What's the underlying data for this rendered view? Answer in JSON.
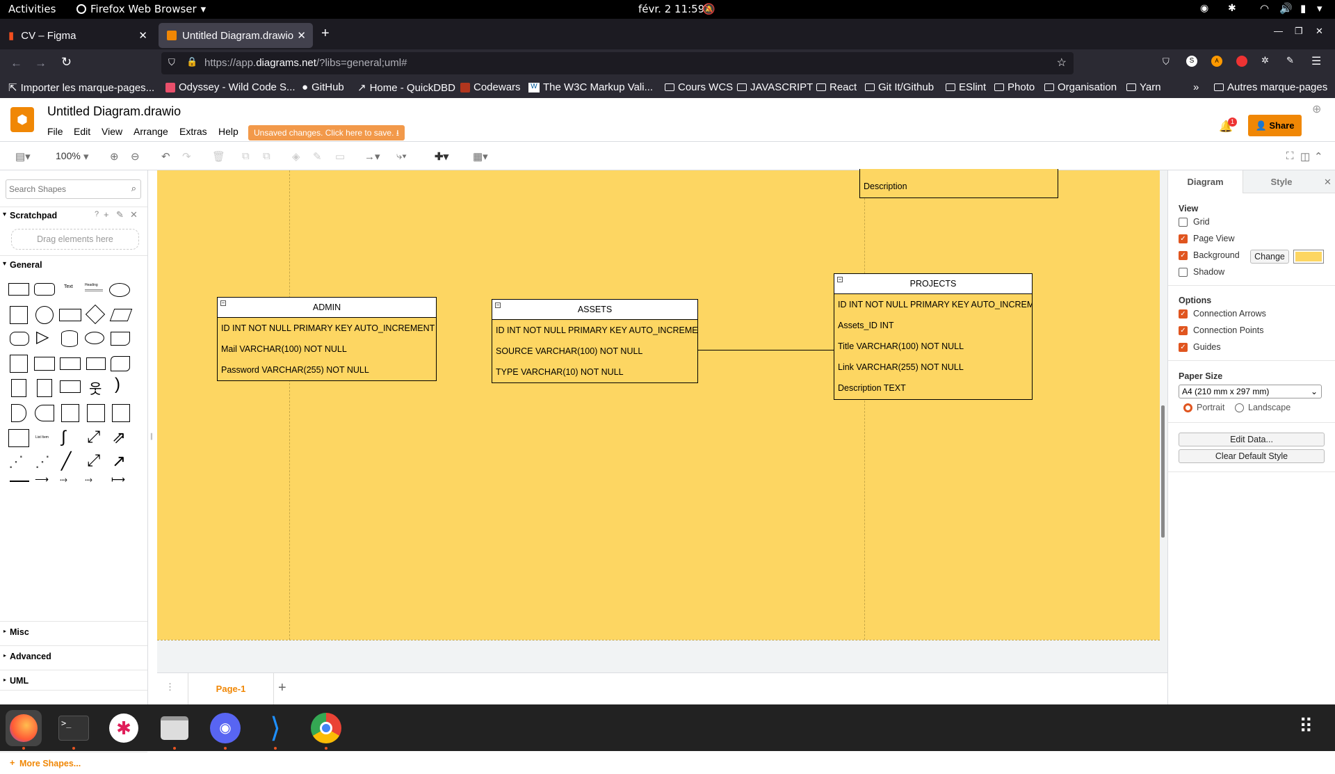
{
  "system_bar": {
    "activities": "Activities",
    "app_name": "Firefox Web Browser",
    "clock": "févr. 2  11:59"
  },
  "tabs": [
    {
      "label": "CV – Figma",
      "active": false
    },
    {
      "label": "Untitled Diagram.drawio",
      "active": true
    }
  ],
  "url": {
    "prefix": "https://app.",
    "host": "diagrams.net",
    "path": "/?libs=general;uml#"
  },
  "bookmarks": [
    "Importer les marque-pages...",
    "Odyssey - Wild Code S...",
    "GitHub",
    "Home - QuickDBD",
    "Codewars",
    "The W3C Markup Vali...",
    "Cours WCS",
    "JAVASCRIPT",
    "React",
    "Git It/Github",
    "ESlint",
    "Photo",
    "Organisation",
    "Yarn",
    "Autres marque-pages"
  ],
  "app": {
    "title": "Untitled Diagram.drawio",
    "menus": [
      "File",
      "Edit",
      "View",
      "Arrange",
      "Extras",
      "Help"
    ],
    "unsaved": "Unsaved changes. Click here to save.",
    "share": "Share",
    "notification_count": "1",
    "zoom": "100%"
  },
  "sidebar": {
    "search_placeholder": "Search Shapes",
    "scratchpad": "Scratchpad",
    "drag_hint": "Drag elements here",
    "general": "General",
    "sections": [
      "Misc",
      "Advanced",
      "UML"
    ],
    "more_shapes": "More Shapes...",
    "text_shape": "Text",
    "heading_shape": "Heading",
    "list_shape": "List Item"
  },
  "diagram": {
    "partial_entity": {
      "row": "Description"
    },
    "entities": [
      {
        "name": "ADMIN",
        "rows": [
          "ID INT NOT NULL PRIMARY KEY AUTO_INCREMENT",
          "Mail VARCHAR(100) NOT NULL",
          "Password VARCHAR(255) NOT NULL"
        ]
      },
      {
        "name": "ASSETS",
        "rows": [
          "ID INT NOT NULL PRIMARY KEY AUTO_INCREMEN",
          "SOURCE VARCHAR(100) NOT NULL",
          "TYPE VARCHAR(10) NOT NULL"
        ]
      },
      {
        "name": "PROJECTS",
        "rows": [
          "ID INT NOT NULL PRIMARY KEY AUTO_INCREME",
          "Assets_ID INT",
          "Title VARCHAR(100) NOT NULL",
          "Link VARCHAR(255) NOT NULL",
          "Description TEXT"
        ]
      }
    ],
    "page_tab": "Page-1"
  },
  "format_panel": {
    "tabs": [
      "Diagram",
      "Style"
    ],
    "view_heading": "View",
    "view_options": [
      {
        "label": "Grid",
        "checked": false
      },
      {
        "label": "Page View",
        "checked": true
      },
      {
        "label": "Background",
        "checked": true
      },
      {
        "label": "Shadow",
        "checked": false
      }
    ],
    "change_button": "Change",
    "background_color": "#fdd662",
    "options_heading": "Options",
    "options": [
      {
        "label": "Connection Arrows",
        "checked": true
      },
      {
        "label": "Connection Points",
        "checked": true
      },
      {
        "label": "Guides",
        "checked": true
      }
    ],
    "paper_size_heading": "Paper Size",
    "paper_size": "A4 (210 mm x 297 mm)",
    "orientation": [
      {
        "label": "Portrait",
        "selected": true
      },
      {
        "label": "Landscape",
        "selected": false
      }
    ],
    "edit_data": "Edit Data...",
    "clear_style": "Clear Default Style"
  },
  "colors": {
    "accent": "#e0551f",
    "share_bg": "#f08705",
    "unsaved_bg": "#f2994a",
    "canvas_bg": "#fdd662"
  }
}
